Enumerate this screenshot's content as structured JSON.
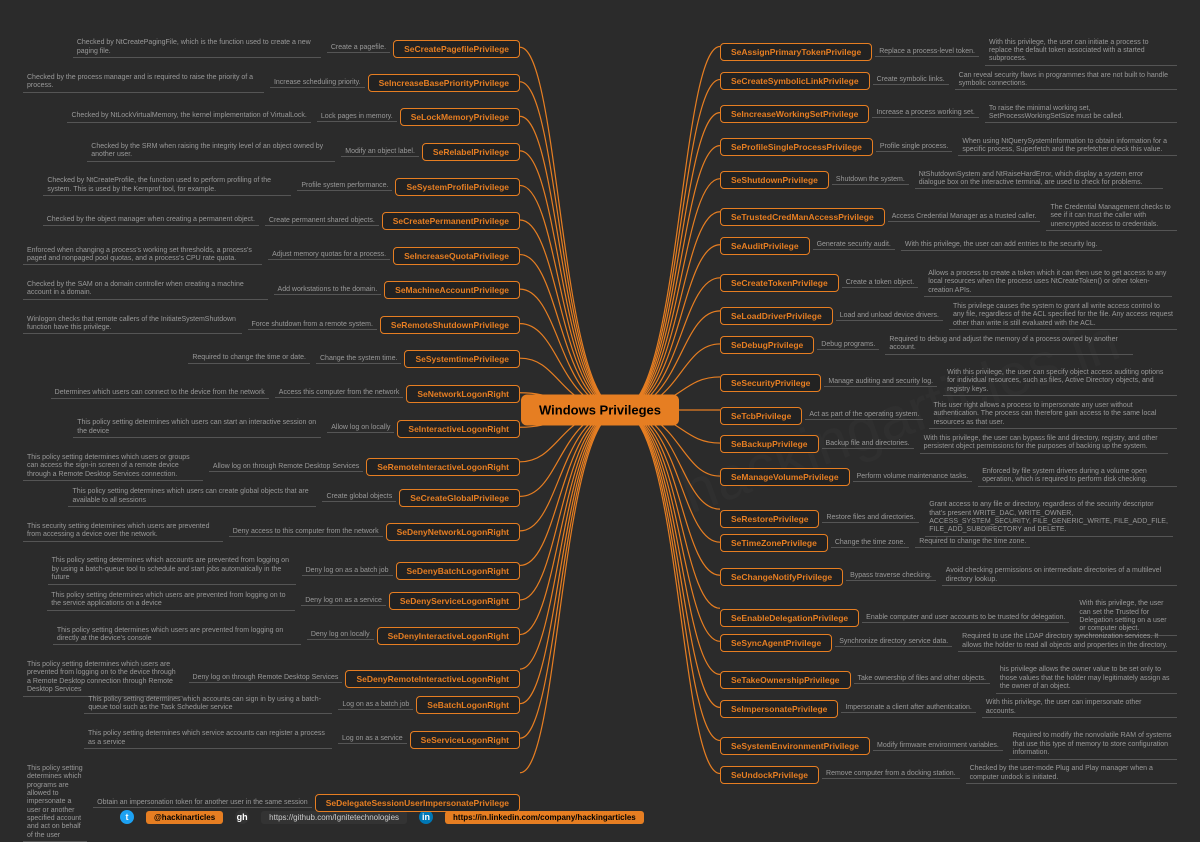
{
  "title": "Windows Privileges",
  "left": [
    {
      "name": "SeCreatePagefilePrivilege",
      "d1": "Create a pagefile.",
      "d2": "Checked by NtCreatePagingFile, which is the function used to create a new paging file."
    },
    {
      "name": "SeIncreaseBasePriorityPrivilege",
      "d1": "Increase scheduling priority.",
      "d2": "Checked by the process manager and is required to raise the priority of a process."
    },
    {
      "name": "SeLockMemoryPrivilege",
      "d1": "Lock pages in memory.",
      "d2": "Checked by NtLockVirtualMemory, the kernel implementation of VirtualLock."
    },
    {
      "name": "SeRelabelPrivilege",
      "d1": "Modify an object label.",
      "d2": "Checked by the SRM when raising the integrity level of an object owned by another user."
    },
    {
      "name": "SeSystemProfilePrivilege",
      "d1": "Profile system performance.",
      "d2": "Checked by NtCreateProfile, the function used to perform profiling of the system. This is used by the Kernprof tool, for example."
    },
    {
      "name": "SeCreatePermanentPrivilege",
      "d1": "Create permanent shared objects.",
      "d2": "Checked by the object manager when creating a permanent object."
    },
    {
      "name": "SeIncreaseQuotaPrivilege",
      "d1": "Adjust memory quotas for a process.",
      "d2": "Enforced when changing a process's working set thresholds, a process's paged and nonpaged pool quotas, and a process's CPU rate quota."
    },
    {
      "name": "SeMachineAccountPrivilege",
      "d1": "Add workstations to the domain.",
      "d2": "Checked by the SAM on a domain controller when creating a machine account in a domain."
    },
    {
      "name": "SeRemoteShutdownPrivilege",
      "d1": "Force shutdown from a remote system.",
      "d2": "Winlogon checks that remote callers of the InitiateSystemShutdown function have this privilege."
    },
    {
      "name": "SeSystemtimePrivilege",
      "d1": "Change the system time.",
      "d2": "Required to change the time or date."
    },
    {
      "name": "SeNetworkLogonRight",
      "d1": "Access this computer from the network",
      "d2": "Determines which users can connect to the device from the network"
    },
    {
      "name": "SeInteractiveLogonRight",
      "d1": "Allow log on locally",
      "d2": "This policy setting determines which users can start an interactive session on the device"
    },
    {
      "name": "SeRemoteInteractiveLogonRight",
      "d1": "Allow log on through Remote Desktop Services",
      "d2": "This policy setting determines which users or groups can access the sign-in screen of a remote device through a Remote Desktop Services connection."
    },
    {
      "name": "SeCreateGlobalPrivilege",
      "d1": "Create global objects",
      "d2": "This policy setting determines which users can create global objects that are available to all sessions"
    },
    {
      "name": "SeDenyNetworkLogonRight",
      "d1": "Deny access to this computer from the network",
      "d2": "This security setting determines which users are prevented from accessing a device over the network."
    },
    {
      "name": "SeDenyBatchLogonRight",
      "d1": "Deny log on as a batch job",
      "d2": "This policy setting determines which accounts are prevented from logging on by using a batch-queue tool to schedule and start jobs automatically in the future"
    },
    {
      "name": "SeDenyServiceLogonRight",
      "d1": "Deny log on as a service",
      "d2": "This policy setting determines which users are prevented from logging on to the service applications on a device"
    },
    {
      "name": "SeDenyInteractiveLogonRight",
      "d1": "Deny log on locally",
      "d2": "This policy setting determines which users are prevented from logging on directly at the device's console"
    },
    {
      "name": "SeDenyRemoteInteractiveLogonRight",
      "d1": "Deny log on through Remote Desktop Services",
      "d2": "This policy setting determines which users are prevented from logging on to the device through a Remote Desktop connection through Remote Desktop Services"
    },
    {
      "name": "SeBatchLogonRight",
      "d1": "Log on as a batch job",
      "d2": "This policy setting determines which accounts can sign in by using a batch-queue tool such as the Task Scheduler service"
    },
    {
      "name": "SeServiceLogonRight",
      "d1": "Log on as a service",
      "d2": "This policy setting determines which service accounts can register a process as a service"
    },
    {
      "name": "SeDelegateSessionUserImpersonatePrivilege",
      "d1": "Obtain an impersonation token for another user in the same session",
      "d2": "This policy setting determines which programs are allowed to impersonate a user or another specified account and act on behalf of the user"
    }
  ],
  "right": [
    {
      "name": "SeAssignPrimaryTokenPrivilege",
      "d1": "Replace a process-level token.",
      "d2": "With this privilege, the user can initiate a process to replace the default token associated with a started subprocess."
    },
    {
      "name": "SeCreateSymbolicLinkPrivilege",
      "d1": "Create symbolic links.",
      "d2": "Can reveal security flaws in programmes that are not built to handle symbolic connections."
    },
    {
      "name": "SeIncreaseWorkingSetPrivilege",
      "d1": "Increase a process working set.",
      "d2": "To raise the minimal working set, SetProcessWorkingSetSize must be called."
    },
    {
      "name": "SeProfileSingleProcessPrivilege",
      "d1": "Profile single process.",
      "d2": "When using NtQuerySystemInformation to obtain information for a specific process, Superfetch and the prefetcher check this value."
    },
    {
      "name": "SeShutdownPrivilege",
      "d1": "Shutdown the system.",
      "d2": "NtShutdownSystem and NtRaiseHardError, which display a system error dialogue box on the interactive terminal, are used to check for problems."
    },
    {
      "name": "SeTrustedCredManAccessPrivilege",
      "d1": "Access Credential Manager as a trusted caller.",
      "d2": "The Credential Management checks to see if it can trust the caller with unencrypted access to credentials."
    },
    {
      "name": "SeAuditPrivilege",
      "d1": "Generate security audit.",
      "d2": "With this privilege, the user can add entries to the security log."
    },
    {
      "name": "SeCreateTokenPrivilege",
      "d1": "Create a token object.",
      "d2": "Allows a process to create a token which it can then use to get access to any local resources when the process uses NtCreateToken() or other token-creation APIs."
    },
    {
      "name": "SeLoadDriverPrivilege",
      "d1": "Load and unload device drivers.",
      "d2": "This privilege causes the system to grant all write access control to any file, regardless of the ACL specified for the file. Any access request other than write is still evaluated with the ACL."
    },
    {
      "name": "SeDebugPrivilege",
      "d1": "Debug programs.",
      "d2": "Required to debug and adjust the memory of a process owned by another account."
    },
    {
      "name": "SeSecurityPrivilege",
      "d1": "Manage auditing and security log.",
      "d2": "With this privilege, the user can specify object access auditing options for individual resources, such as files, Active Directory objects, and registry keys."
    },
    {
      "name": "SeTcbPrivilege",
      "d1": "Act as part of the operating system.",
      "d2": "This user right allows a process to impersonate any user without authentication. The process can therefore gain access to the same local resources as that user."
    },
    {
      "name": "SeBackupPrivilege",
      "d1": "Backup file and directories.",
      "d2": "With this privilege, the user can bypass file and directory, registry, and other persistent object permissions for the purposes of backing up the system."
    },
    {
      "name": "SeManageVolumePrivilege",
      "d1": "Perform volume maintenance tasks.",
      "d2": "Enforced by file system drivers during a volume open operation, which is required to perform disk checking."
    },
    {
      "name": "SeRestorePrivilege",
      "d1": "Restore files and directories.",
      "d2": "Grant access to any file or directory, regardless of the security descriptor that's present WRITE_DAC, WRITE_OWNER, ACCESS_SYSTEM_SECURITY, FILE_GENERIC_WRITE, FILE_ADD_FILE, FILE_ADD_SUBDIRECTORY and DELETE."
    },
    {
      "name": "SeTimeZonePrivilege",
      "d1": "Change the time zone.",
      "d2": "Required to change the time zone."
    },
    {
      "name": "SeChangeNotifyPrivilege",
      "d1": "Bypass traverse checking.",
      "d2": "Avoid checking permissions on intermediate directories of a multilevel directory lookup."
    },
    {
      "name": "SeEnableDelegationPrivilege",
      "d1": "Enable computer and user accounts to be trusted for delegation.",
      "d2": "With this privilege, the user can set the Trusted for Delegation setting on a user or computer object."
    },
    {
      "name": "SeSyncAgentPrivilege",
      "d1": "Synchronize directory service data.",
      "d2": "Required to use the LDAP directory synchronization services. It allows the holder to read all objects and properties in the directory."
    },
    {
      "name": "SeTakeOwnershipPrivilege",
      "d1": "Take ownership of files and other objects.",
      "d2": "his privilege allows the owner value to be set only to those values that the holder may legitimately assign as the owner of an object."
    },
    {
      "name": "SeImpersonatePrivilege",
      "d1": "Impersonate a client after authentication.",
      "d2": "With this privilege, the user can impersonate other accounts."
    },
    {
      "name": "SeSystemEnvironmentPrivilege",
      "d1": "Modify firmware environment variables.",
      "d2": "Required to modify the nonvolatile RAM of systems that use this type of memory to store configuration information."
    },
    {
      "name": "SeUndockPrivilege",
      "d1": "Remove computer from a docking station.",
      "d2": "Checked by the user-mode Plug and Play manager when a computer undock is initiated."
    }
  ],
  "footer": {
    "twitter": "@hackinarticles",
    "github": "https://github.com/Ignitetechnologies",
    "linkedin": "https://in.linkedin.com/company/hackingarticles"
  }
}
